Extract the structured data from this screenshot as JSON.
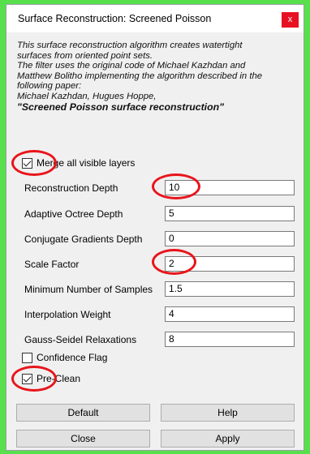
{
  "window": {
    "title": "Surface Reconstruction: Screened Poisson",
    "close_glyph": "x"
  },
  "description": {
    "lines": [
      "This surface reconstruction algorithm creates watertight",
      "surfaces from oriented point sets.",
      "The filter uses the original code of Michael Kazhdan and",
      "Matthew Bolitho implementing the algorithm described in the",
      "following paper:",
      "Michael Kazhdan, Hugues Hoppe,"
    ],
    "reference": "\"Screened Poisson surface reconstruction\""
  },
  "checkboxes": {
    "merge_layers": {
      "label": "Merge all visible layers",
      "checked": true
    },
    "confidence_flag": {
      "label": "Confidence Flag",
      "checked": false
    },
    "pre_clean": {
      "label": "Pre-Clean",
      "checked": true
    }
  },
  "fields": {
    "reconstruction_depth": {
      "label": "Reconstruction Depth",
      "value": "10"
    },
    "adaptive_octree_depth": {
      "label": "Adaptive Octree Depth",
      "value": "5"
    },
    "conjugate_gradients_depth": {
      "label": "Conjugate Gradients Depth",
      "value": "0"
    },
    "scale_factor": {
      "label": "Scale Factor",
      "value": "2"
    },
    "min_samples": {
      "label": "Minimum Number of Samples",
      "value": "1.5"
    },
    "interpolation_weight": {
      "label": "Interpolation Weight",
      "value": "4"
    },
    "gauss_seidel": {
      "label": "Gauss-Seidel Relaxations",
      "value": "8"
    }
  },
  "buttons": {
    "default": "Default",
    "help": "Help",
    "close": "Close",
    "apply": "Apply"
  },
  "colors": {
    "background": "#57e04c",
    "close_button": "#e81123",
    "highlight_ring": "#e8151b"
  }
}
